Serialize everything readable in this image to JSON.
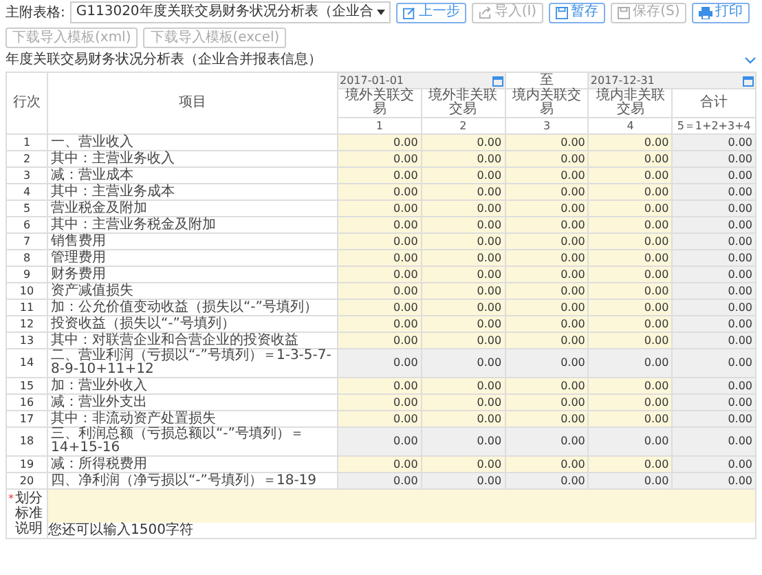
{
  "toolbar": {
    "label": "主附表格:",
    "select": "G113020年度关联交易财务状况分析表（企业合",
    "buttons": [
      {
        "label": "上一步",
        "kind": "prev",
        "disabled": false
      },
      {
        "label": "导入(I)",
        "kind": "import",
        "disabled": true
      },
      {
        "label": "暂存",
        "kind": "stash",
        "disabled": false
      },
      {
        "label": "保存(S)",
        "kind": "save",
        "disabled": true
      },
      {
        "label": "打印",
        "kind": "print",
        "disabled": false
      },
      {
        "label": "下载导入模板(xml)",
        "kind": "download",
        "disabled": true
      },
      {
        "label": "下载导入模板(excel)",
        "kind": "download",
        "disabled": true
      }
    ]
  },
  "title": "年度关联交易财务状况分析表（企业合并报表信息）",
  "table": {
    "row_no_header": "行次",
    "item_header": "项目",
    "period": {
      "start": "2017-01-01",
      "separator": "至",
      "end": "2017-12-31"
    },
    "column_headers": [
      {
        "name": "境外关联交易",
        "number": "1"
      },
      {
        "name": "境外非关联交易",
        "number": "2"
      },
      {
        "name": "境内关联交易",
        "number": "3"
      },
      {
        "name": "境内非关联交易",
        "number": "4"
      },
      {
        "name": "合计",
        "number": "5＝1+2+3+4"
      }
    ],
    "rows": [
      {
        "no": "1",
        "item": "一、营业收入",
        "kind": "input",
        "values": [
          "0.00",
          "0.00",
          "0.00",
          "0.00",
          "0.00"
        ]
      },
      {
        "no": "2",
        "item": "其中：主营业务收入",
        "kind": "input",
        "values": [
          "0.00",
          "0.00",
          "0.00",
          "0.00",
          "0.00"
        ]
      },
      {
        "no": "3",
        "item": "减：营业成本",
        "kind": "input",
        "values": [
          "0.00",
          "0.00",
          "0.00",
          "0.00",
          "0.00"
        ]
      },
      {
        "no": "4",
        "item": "其中：主营业务成本",
        "kind": "input",
        "values": [
          "0.00",
          "0.00",
          "0.00",
          "0.00",
          "0.00"
        ]
      },
      {
        "no": "5",
        "item": "营业税金及附加",
        "kind": "input",
        "values": [
          "0.00",
          "0.00",
          "0.00",
          "0.00",
          "0.00"
        ]
      },
      {
        "no": "6",
        "item": "其中：主营业务税金及附加",
        "kind": "input",
        "values": [
          "0.00",
          "0.00",
          "0.00",
          "0.00",
          "0.00"
        ]
      },
      {
        "no": "7",
        "item": "销售费用",
        "kind": "input",
        "values": [
          "0.00",
          "0.00",
          "0.00",
          "0.00",
          "0.00"
        ]
      },
      {
        "no": "8",
        "item": "管理费用",
        "kind": "input",
        "values": [
          "0.00",
          "0.00",
          "0.00",
          "0.00",
          "0.00"
        ]
      },
      {
        "no": "9",
        "item": "财务费用",
        "kind": "input",
        "values": [
          "0.00",
          "0.00",
          "0.00",
          "0.00",
          "0.00"
        ]
      },
      {
        "no": "10",
        "item": "资产减值损失",
        "kind": "input",
        "values": [
          "0.00",
          "0.00",
          "0.00",
          "0.00",
          "0.00"
        ]
      },
      {
        "no": "11",
        "item": "加：公允价值变动收益（损失以“-”号填列）",
        "kind": "input",
        "values": [
          "0.00",
          "0.00",
          "0.00",
          "0.00",
          "0.00"
        ]
      },
      {
        "no": "12",
        "item": "投资收益（损失以“-”号填列）",
        "kind": "input",
        "values": [
          "0.00",
          "0.00",
          "0.00",
          "0.00",
          "0.00"
        ]
      },
      {
        "no": "13",
        "item": "其中：对联营企业和合营企业的投资收益",
        "kind": "input",
        "values": [
          "0.00",
          "0.00",
          "0.00",
          "0.00",
          "0.00"
        ]
      },
      {
        "no": "14",
        "item": "二、营业利润（亏损以“-”号填列）＝1-3-5-7-8-9-10+11+12",
        "kind": "calc",
        "values": [
          "0.00",
          "0.00",
          "0.00",
          "0.00",
          "0.00"
        ]
      },
      {
        "no": "15",
        "item": "加：营业外收入",
        "kind": "input",
        "values": [
          "0.00",
          "0.00",
          "0.00",
          "0.00",
          "0.00"
        ]
      },
      {
        "no": "16",
        "item": "减：营业外支出",
        "kind": "input",
        "values": [
          "0.00",
          "0.00",
          "0.00",
          "0.00",
          "0.00"
        ]
      },
      {
        "no": "17",
        "item": "其中：非流动资产处置损失",
        "kind": "input",
        "values": [
          "0.00",
          "0.00",
          "0.00",
          "0.00",
          "0.00"
        ]
      },
      {
        "no": "18",
        "item": "三、利润总额（亏损总额以“-”号填列）＝14+15-16",
        "kind": "calc",
        "values": [
          "0.00",
          "0.00",
          "0.00",
          "0.00",
          "0.00"
        ]
      },
      {
        "no": "19",
        "item": "减：所得税费用",
        "kind": "input",
        "values": [
          "0.00",
          "0.00",
          "0.00",
          "0.00",
          "0.00"
        ]
      },
      {
        "no": "20",
        "item": "四、净利润（净亏损以“-”号填列）＝18-19",
        "kind": "calc",
        "values": [
          "0.00",
          "0.00",
          "0.00",
          "0.00",
          "0.00"
        ]
      }
    ]
  },
  "remark": {
    "required": true,
    "required_mark": "*",
    "label": "划分标准说明",
    "hint": "您还可以输入1500字符"
  }
}
